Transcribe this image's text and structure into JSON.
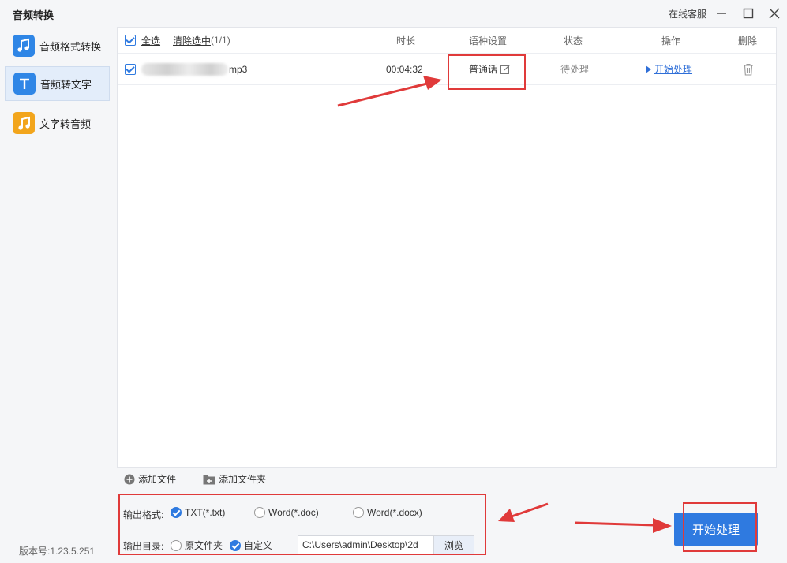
{
  "window": {
    "title": "音频转换",
    "service_label": "在线客服"
  },
  "sidebar": {
    "items": [
      {
        "label": "音频格式转换",
        "icon": "music-note-icon",
        "color": "#2f86e6"
      },
      {
        "label": "音频转文字",
        "icon": "text-t-icon",
        "color": "#2f86e6"
      },
      {
        "label": "文字转音频",
        "icon": "music-note-icon",
        "color": "#f2a51c"
      }
    ],
    "active_index": 1,
    "version": "版本号:1.23.5.251"
  },
  "table": {
    "select_all": "全选",
    "clear_selected": "清除选中",
    "selection_count": "(1/1)",
    "headers": {
      "duration": "时长",
      "language": "语种设置",
      "status": "状态",
      "action": "操作",
      "delete": "删除"
    },
    "rows": [
      {
        "filename_suffix": "mp3",
        "duration": "00:04:32",
        "language": "普通话",
        "status": "待处理",
        "action": "开始处理"
      }
    ]
  },
  "toolbar": {
    "add_file": "添加文件",
    "add_folder": "添加文件夹"
  },
  "output": {
    "format_label": "输出格式:",
    "formats": [
      "TXT(*.txt)",
      "Word(*.doc)",
      "Word(*.docx)"
    ],
    "selected_format_index": 0,
    "dir_label": "输出目录:",
    "dir_options": [
      "原文件夹",
      "自定义"
    ],
    "selected_dir_index": 1,
    "path": "C:\\Users\\admin\\Desktop\\2d",
    "browse": "浏览"
  },
  "start_button": "开始处理",
  "colors": {
    "accent": "#2f7ae0",
    "highlight": "#e03a3a"
  }
}
